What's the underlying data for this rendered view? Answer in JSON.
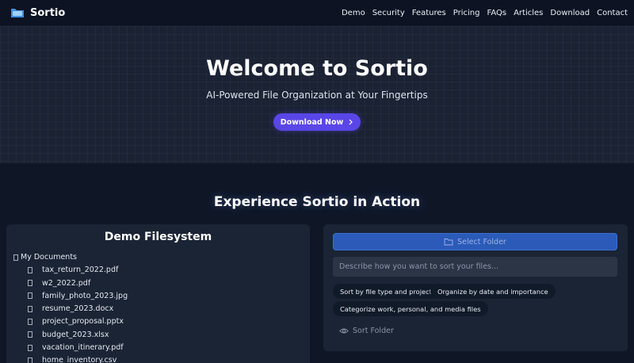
{
  "nav": {
    "brand": "Sortio",
    "links": [
      "Demo",
      "Security",
      "Features",
      "Pricing",
      "FAQs",
      "Articles",
      "Download",
      "Contact"
    ]
  },
  "hero": {
    "title": "Welcome to Sortio",
    "subtitle": "AI-Powered File Organization at Your Fingertips",
    "cta": "Download Now"
  },
  "demo": {
    "section_title": "Experience Sortio in Action",
    "filesystem": {
      "title": "Demo Filesystem",
      "root": "My Documents",
      "files": [
        "tax_return_2022.pdf",
        "w2_2022.pdf",
        "family_photo_2023.jpg",
        "resume_2023.docx",
        "project_proposal.pptx",
        "budget_2023.xlsx",
        "vacation_itinerary.pdf",
        "home_inventory.csv"
      ]
    },
    "sorter": {
      "select_folder": "Select Folder",
      "description_placeholder": "Describe how you want to sort your files...",
      "suggestions": [
        "Sort by file type and project",
        "Organize by date and importance",
        "Categorize work, personal, and media files"
      ],
      "sort_button": "Sort Folder"
    }
  },
  "icons": {
    "logo": "folder-logo-icon",
    "cta": "chevron-right-icon",
    "root": "folder-glyph-icon",
    "file": "file-glyph-icon",
    "select": "folder-icon",
    "sort": "eye-icon"
  },
  "colors": {
    "background": "#0f1727",
    "hero_background": "#1a2233",
    "panel": "#1b2434",
    "accent": "#5a46e8",
    "select_button": "#2b5ab8"
  }
}
